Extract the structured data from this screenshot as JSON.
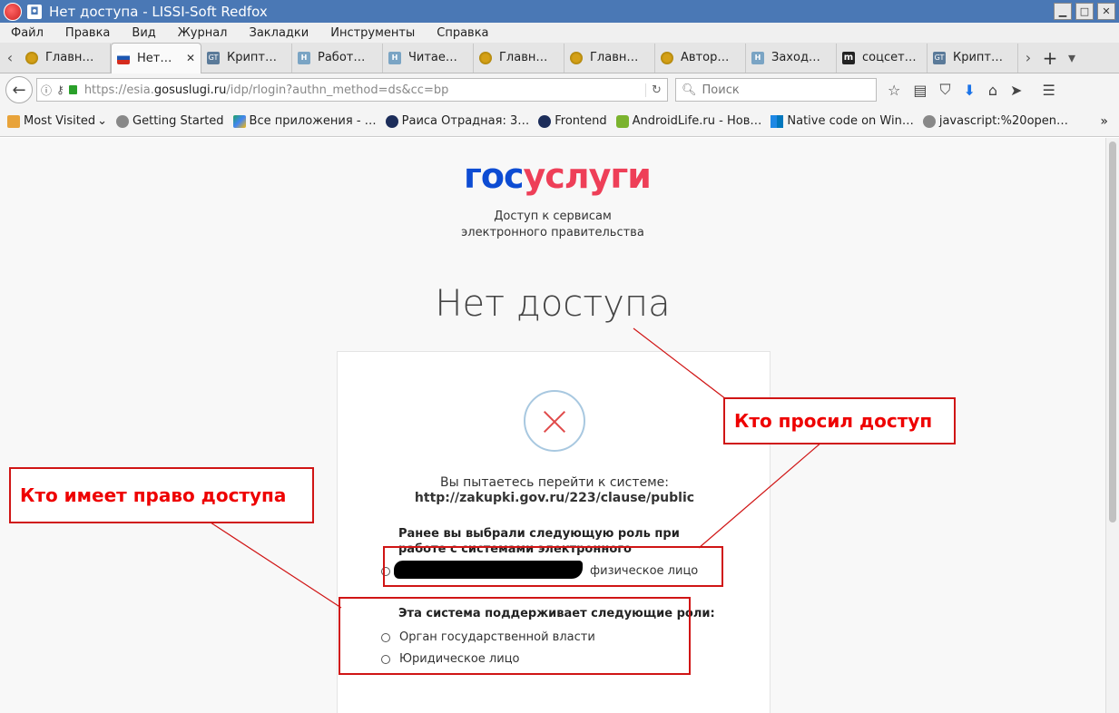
{
  "window": {
    "title": "Нет доступа - LISSI-Soft Redfox"
  },
  "menu": [
    "Файл",
    "Правка",
    "Вид",
    "Журнал",
    "Закладки",
    "Инструменты",
    "Справка"
  ],
  "tabs": [
    {
      "label": "Главн…",
      "icon": "eagle-icon"
    },
    {
      "label": "Нет…",
      "icon": "flag-icon",
      "active": true
    },
    {
      "label": "Крипт…",
      "icon": "gt-icon"
    },
    {
      "label": "Работ…",
      "icon": "h-icon"
    },
    {
      "label": "Читае…",
      "icon": "h-icon"
    },
    {
      "label": "Главн…",
      "icon": "eagle-icon"
    },
    {
      "label": "Главн…",
      "icon": "eagle-icon"
    },
    {
      "label": "Автор…",
      "icon": "eagle-icon"
    },
    {
      "label": "Заход…",
      "icon": "h-icon"
    },
    {
      "label": "соцсет…",
      "icon": "m-icon"
    },
    {
      "label": "Крипт…",
      "icon": "gt-icon"
    }
  ],
  "nav": {
    "url_prefix": "https://esia.",
    "url_domain": "gosuslugi.ru",
    "url_suffix": "/idp/rlogin?authn_method=ds&cc=bp",
    "search_placeholder": "Поиск"
  },
  "bookmarks": [
    {
      "label": "Most Visited",
      "icon": "folder"
    },
    {
      "label": "Getting Started",
      "icon": "globe"
    },
    {
      "label": "Все приложения - …",
      "icon": "play"
    },
    {
      "label": "Раиса Отрадная: 3…",
      "icon": "dark"
    },
    {
      "label": "Frontend",
      "icon": "dark"
    },
    {
      "label": "AndroidLife.ru - Нов…",
      "icon": "android"
    },
    {
      "label": "Native code on Win…",
      "icon": "win"
    },
    {
      "label": "javascript:%20open…",
      "icon": "globe"
    }
  ],
  "page": {
    "logo_part1": "гос",
    "logo_part2": "услуги",
    "subtitle_line1": "Доступ к сервисам",
    "subtitle_line2": "электронного правительства",
    "heading": "Нет доступа",
    "try_text": "Вы пытаетесь перейти к системе:",
    "try_url": "http://zakupki.gov.ru/223/clause/public",
    "role_heading": "Ранее вы выбрали следующую роль при работе с системами электронного правительства:",
    "selected_role": "физическое лицо",
    "supported_heading": "Эта система поддерживает следующие роли:",
    "supported_roles": [
      "Орган государственной власти",
      "Юридическое лицо"
    ]
  },
  "annotations": {
    "who_requested": "Кто просил доступ",
    "who_has_access": "Кто имеет право доступа",
    "color": "#e00000"
  }
}
